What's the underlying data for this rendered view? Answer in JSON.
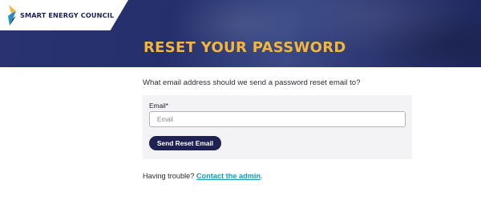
{
  "brand": {
    "name": "SMART ENERGY COUNCIL",
    "colors": {
      "navy": "#1f2152",
      "gold": "#f3b53d",
      "teal": "#1b9ab7",
      "blue": "#2a86c8"
    },
    "logo_icon": "sec-logo-icon"
  },
  "header": {
    "title": "RESET YOUR PASSWORD"
  },
  "form": {
    "prompt": "What email address should we send a password reset email to?",
    "email_label": "Email*",
    "email_placeholder": "Email",
    "email_value": "",
    "submit_label": "Send Reset Email"
  },
  "help": {
    "text": "Having trouble?",
    "link_label": "Contact the admin",
    "suffix": "."
  }
}
